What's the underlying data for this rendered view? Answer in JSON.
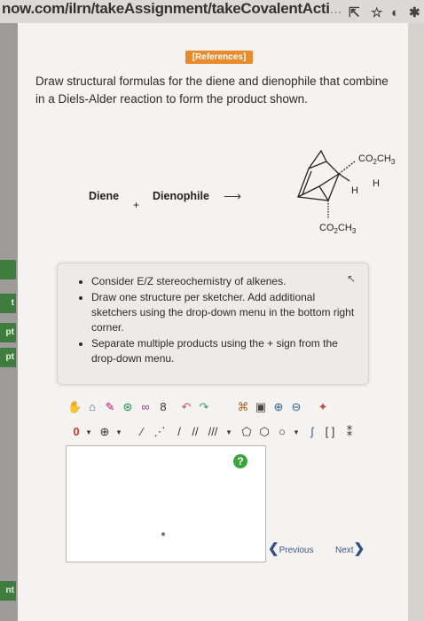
{
  "browser": {
    "url_main": "now.com/ilrn/takeAssignment/takeCovalentActi",
    "url_dim": "...",
    "icons": [
      "share-icon",
      "star-icon",
      "extension-icon",
      "puzzle-icon"
    ]
  },
  "left_tabs": [
    "t",
    "pt",
    "pt",
    "nt"
  ],
  "references_label": "[References]",
  "question": "Draw structural formulas for the diene and dienophile that combine in a Diels-Alder reaction to form the product shown.",
  "reaction": {
    "diene_label": "Diene",
    "plus": "+",
    "dienophile_label": "Dienophile",
    "arrow": "⟶"
  },
  "product": {
    "top_substituent": "CO2CH3",
    "h1": "H",
    "h2": "H",
    "bottom_substituent": "CO2CH3"
  },
  "instructions": [
    "Consider E/Z stereochemistry of alkenes.",
    "Draw one structure per sketcher. Add additional sketchers using the drop-down menu in the bottom right corner.",
    "Separate multiple products using the + sign from the drop-down menu."
  ],
  "sketcher": {
    "help": "?",
    "charge_label": "0",
    "add_label": "⊕"
  },
  "nav": {
    "previous": "Previous",
    "next": "Next"
  }
}
